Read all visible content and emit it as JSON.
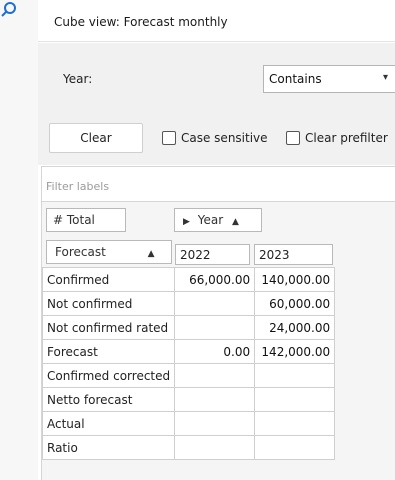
{
  "window": {
    "title": "Cube view: Forecast monthly"
  },
  "filter": {
    "year_label": "Year:",
    "condition": "Contains",
    "clear_label": "Clear",
    "case_sensitive_label": "Case sensitive",
    "clear_prefilter_label": "Clear prefilter"
  },
  "grid": {
    "filter_placeholder": "Filter labels",
    "total_chip": "# Total",
    "year_chip": "Year",
    "row_header": "Forecast",
    "columns": [
      "2022",
      "2023"
    ],
    "rows": [
      {
        "label": "Confirmed",
        "v2022": "66,000.00",
        "v2023": "140,000.00"
      },
      {
        "label": "Not confirmed",
        "v2022": "",
        "v2023": "60,000.00"
      },
      {
        "label": "Not confirmed rated",
        "v2022": "",
        "v2023": "24,000.00"
      },
      {
        "label": "Forecast",
        "v2022": "0.00",
        "v2023": "142,000.00"
      },
      {
        "label": "Confirmed corrected",
        "v2022": "",
        "v2023": ""
      },
      {
        "label": "Netto forecast",
        "v2022": "",
        "v2023": ""
      },
      {
        "label": "Actual",
        "v2022": "",
        "v2023": ""
      },
      {
        "label": "Ratio",
        "v2022": "",
        "v2023": ""
      }
    ]
  },
  "colors": {
    "accent": "#1e6fd0",
    "panel": "#f1f1f1"
  },
  "icons": {
    "search": "search-icon",
    "sort_up": "sort-ascending-icon",
    "expand": "expand-arrow-icon"
  }
}
